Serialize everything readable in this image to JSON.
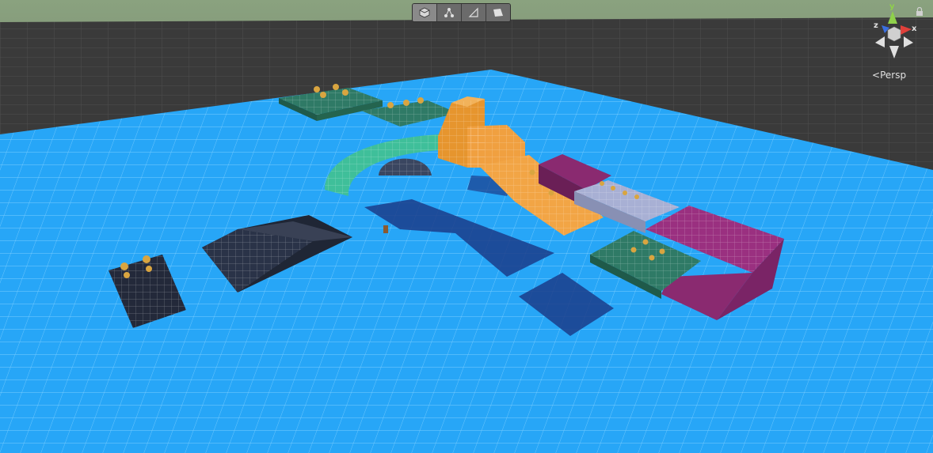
{
  "scene_toolbar": {
    "buttons": [
      {
        "icon": "cube-icon",
        "active": true
      },
      {
        "icon": "nodes-icon",
        "active": false
      },
      {
        "icon": "triangle-icon",
        "active": false
      },
      {
        "icon": "quad-icon",
        "active": false
      }
    ]
  },
  "gizmo": {
    "y_label": "y",
    "x_label": "x",
    "z_label": "z",
    "projection_label": "Persp",
    "lock_icon": "lock-icon",
    "colors": {
      "x": "#e0403a",
      "y": "#8fd14a",
      "z": "#3a6fe0"
    }
  },
  "colors": {
    "sky_top": "#6e8a6a",
    "ground_dark": "#3a3a3a",
    "floor_blue": "#2aa3f5",
    "teal": "#2f7a66",
    "mint": "#3fbf9a",
    "orange": "#f0a040",
    "magenta": "#8a2a70",
    "slate": "#2a3348",
    "lavender": "#9aa4c8"
  }
}
